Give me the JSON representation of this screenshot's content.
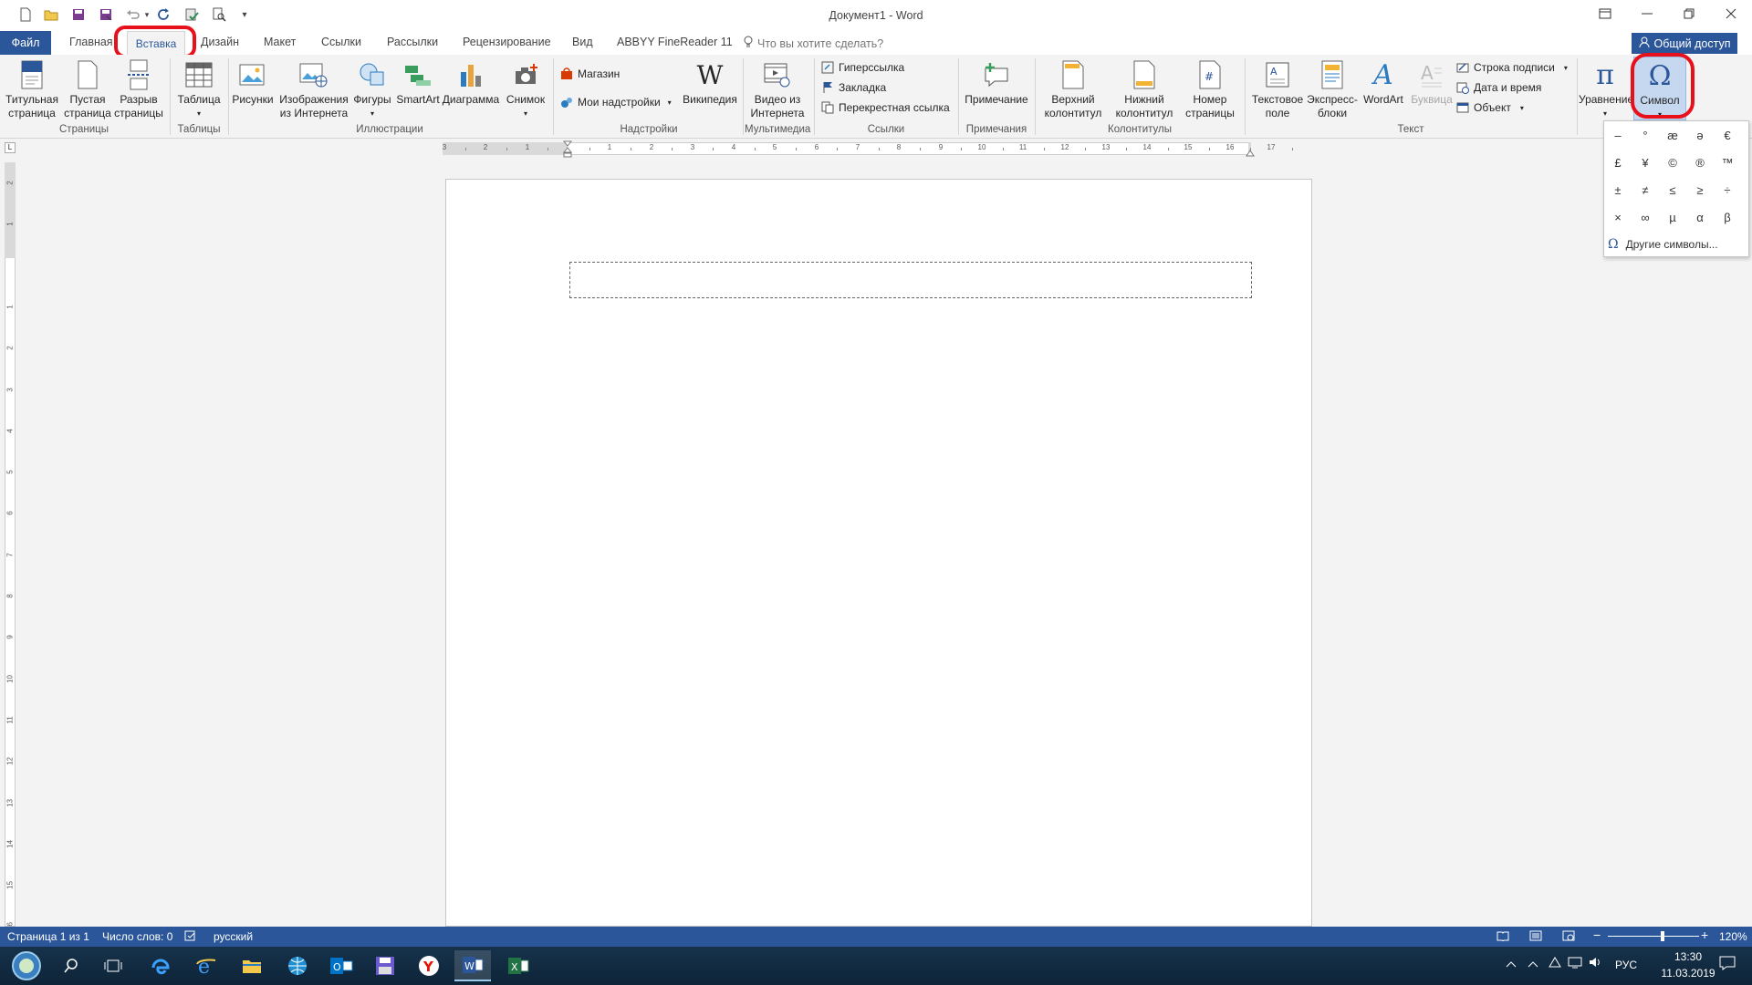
{
  "window": {
    "title": "Документ1 - Word"
  },
  "qat": [
    {
      "name": "new-document-icon",
      "glyph": "🗋"
    },
    {
      "name": "open-folder-icon",
      "glyph": "📂"
    },
    {
      "name": "save-icon",
      "glyph": "💾"
    },
    {
      "name": "save-as-icon",
      "glyph": "🖫"
    },
    {
      "name": "undo-icon",
      "glyph": "↶"
    },
    {
      "name": "redo-icon",
      "glyph": "↻"
    },
    {
      "name": "spellcheck-icon",
      "glyph": "✔"
    },
    {
      "name": "print-preview-icon",
      "glyph": "🔍"
    },
    {
      "name": "customize-qat-icon",
      "glyph": "▾"
    }
  ],
  "tabs": {
    "file": "Файл",
    "home": "Главная",
    "insert": "Вставка",
    "design": "Дизайн",
    "layout": "Макет",
    "references": "Ссылки",
    "mailings": "Рассылки",
    "review": "Рецензирование",
    "view": "Вид",
    "abbyy": "ABBYY FineReader 11",
    "tell_me": "Что вы хотите сделать?",
    "share": "Общий доступ"
  },
  "ribbon": {
    "cover_page": "Титульная\nстраница",
    "blank_page": "Пустая\nстраница",
    "page_break": "Разрыв\nстраницы",
    "table": "Таблица",
    "pictures": "Рисунки",
    "online_pictures": "Изображения\nиз Интернета",
    "shapes": "Фигуры",
    "smartart": "SmartArt",
    "chart": "Диаграмма",
    "screenshot": "Снимок",
    "store": "Магазин",
    "my_addins": "Мои надстройки",
    "wikipedia": "Википедия",
    "online_video": "Видео из\nИнтернета",
    "hyperlink": "Гиперссылка",
    "bookmark": "Закладка",
    "cross_reference": "Перекрестная ссылка",
    "comment": "Примечание",
    "header": "Верхний\nколонтитул",
    "footer": "Нижний\nколонтитул",
    "page_number": "Номер\nстраницы",
    "text_box": "Текстовое\nполе",
    "quick_parts": "Экспресс-\nблоки",
    "wordart": "WordArt",
    "drop_cap": "Буквица",
    "signature_line": "Строка подписи",
    "date_time": "Дата и время",
    "object": "Объект",
    "equation": "Уравнение",
    "symbol": "Символ"
  },
  "groups": {
    "pages": "Страницы",
    "tables": "Таблицы",
    "illustrations": "Иллюстрации",
    "addins": "Надстройки",
    "media": "Мультимедиа",
    "links": "Ссылки",
    "comments": "Примечания",
    "header_footer": "Колонтитулы",
    "text": "Текст"
  },
  "symbol_gallery": {
    "symbols": [
      "–",
      "°",
      "æ",
      "ә",
      "€",
      "£",
      "¥",
      "©",
      "®",
      "™",
      "±",
      "≠",
      "≤",
      "≥",
      "÷",
      "×",
      "∞",
      "µ",
      "α",
      "β"
    ],
    "more": "Другие символы..."
  },
  "ruler": {
    "h_labels": [
      "3",
      "2",
      "1",
      "",
      "1",
      "2",
      "3",
      "4",
      "5",
      "6",
      "7",
      "8",
      "9",
      "10",
      "11",
      "12",
      "13",
      "14",
      "15",
      "16",
      "17"
    ],
    "v_labels": [
      "2",
      "1",
      "",
      "1",
      "2",
      "3",
      "4",
      "5",
      "6",
      "7",
      "8",
      "9",
      "10",
      "11",
      "12",
      "13",
      "14",
      "15",
      "16"
    ]
  },
  "status": {
    "page": "Страница 1 из 1",
    "words": "Число слов: 0",
    "language": "русский",
    "zoom": "120%",
    "zoom_level": 0.6
  },
  "taskbar": {
    "lang": "РУС",
    "time": "13:30",
    "date": "11.03.2019"
  },
  "colors": {
    "accent": "#2b579a",
    "highlight": "#e8101a"
  }
}
